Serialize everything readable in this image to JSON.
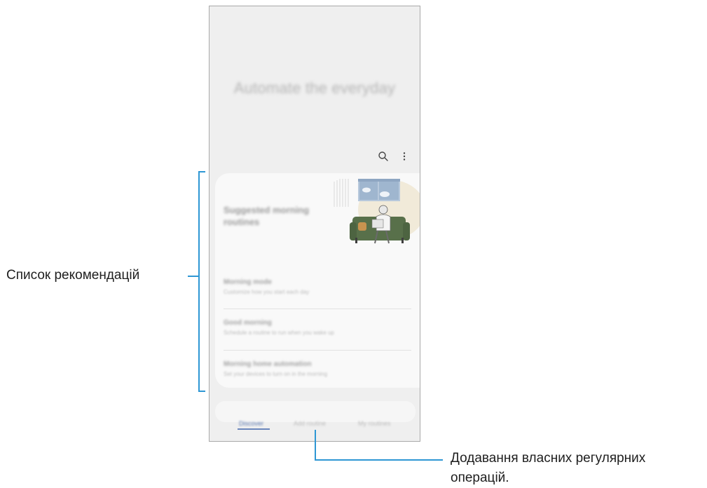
{
  "screen": {
    "hero_title": "Automate the everyday",
    "toolbar": {
      "search_icon": "search-icon",
      "more_icon": "more-vert-icon"
    },
    "suggestions_card": {
      "title": "Suggested morning routines",
      "items": [
        {
          "title": "Morning mode",
          "subtitle": "Customize how you start each day"
        },
        {
          "title": "Good morning",
          "subtitle": "Schedule a routine to run when you wake up"
        },
        {
          "title": "Morning home automation",
          "subtitle": "Set your devices to turn on in the morning"
        }
      ]
    },
    "tabs": [
      {
        "label": "Discover",
        "active": true
      },
      {
        "label": "Add routine",
        "active": false
      },
      {
        "label": "My routines",
        "active": false
      }
    ]
  },
  "annotations": {
    "suggestions_list": "Список рекомендацій",
    "add_routine_line1": "Додавання власних регулярних",
    "add_routine_line2": "операцій."
  },
  "colors": {
    "callout_line": "#2e97d4",
    "active_tab": "#5a78b0",
    "screen_bg": "#efefef"
  }
}
